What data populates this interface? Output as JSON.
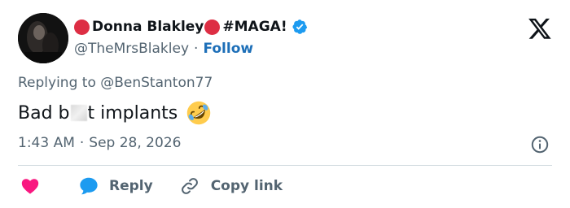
{
  "tweet": {
    "author": {
      "name": "Donna Blakley",
      "name_suffix": "#MAGA!",
      "handle": "@TheMrsBlakley",
      "separator": "·",
      "follow_label": "Follow",
      "verified": true
    },
    "reply_context": {
      "prefix": "Replying to",
      "mention": "@BenStanton77"
    },
    "body": {
      "before_censor": "Bad b",
      "after_censor": "t implants",
      "emoji": "rolling-on-the-floor-laughing"
    },
    "timestamp": {
      "time": "1:43 AM",
      "separator": "·",
      "date": "Sep 28, 2026"
    },
    "actions": {
      "reply_label": "Reply",
      "copy_label": "Copy link"
    }
  },
  "colors": {
    "accent": "#1d9bf0",
    "follow": "#1d6fb8",
    "like": "#f91880",
    "muted_text": "#536471",
    "primary_text": "#0f1419",
    "red_circle": "#dd2e44",
    "divider": "#cfd9de"
  },
  "icons": {
    "brand": "x-logo-icon",
    "verified": "verified-badge-icon",
    "info": "info-icon",
    "like": "heart-icon",
    "reply": "speech-bubble-icon",
    "copy": "link-icon"
  }
}
